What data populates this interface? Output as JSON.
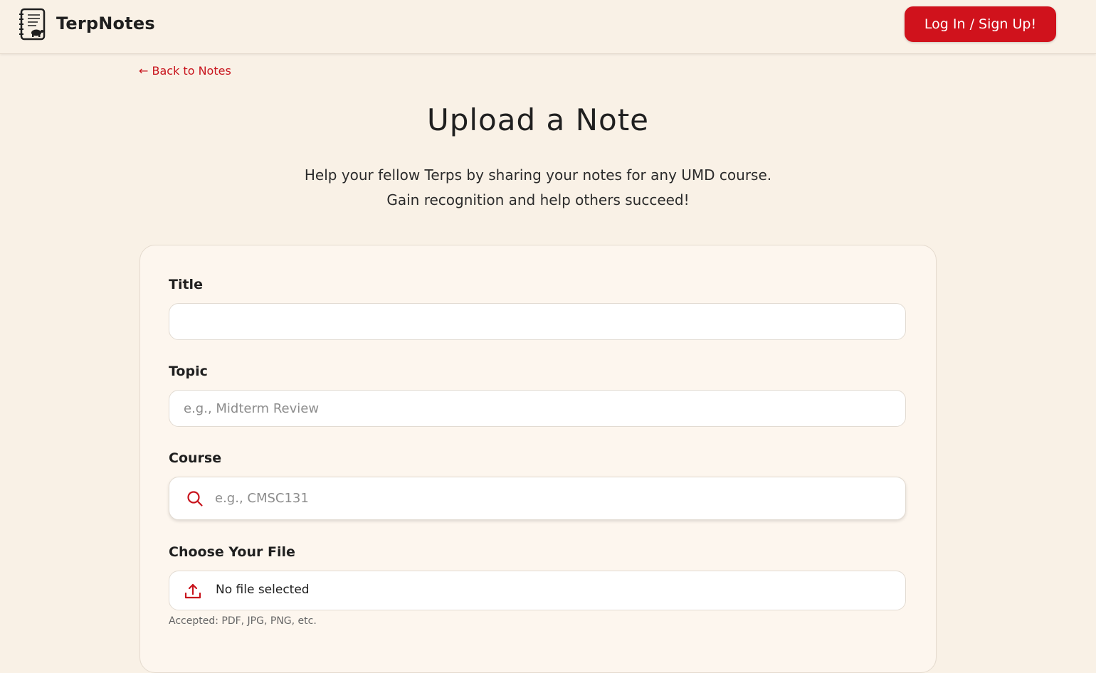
{
  "header": {
    "brand": "TerpNotes",
    "login_label": "Log In / Sign Up!"
  },
  "nav": {
    "back_label": "← Back to Notes"
  },
  "main": {
    "title": "Upload a Note",
    "subtitle_line1": "Help your fellow Terps by sharing your notes for any UMD course.",
    "subtitle_line2": "Gain recognition and help others succeed!"
  },
  "form": {
    "title": {
      "label": "Title",
      "value": "",
      "placeholder": ""
    },
    "topic": {
      "label": "Topic",
      "value": "",
      "placeholder": "e.g., Midterm Review"
    },
    "course": {
      "label": "Course",
      "value": "",
      "placeholder": "e.g., CMSC131"
    },
    "file": {
      "label": "Choose Your File",
      "status": "No file selected",
      "accepted": "Accepted: PDF, JPG, PNG, etc."
    }
  },
  "icons": {
    "logo": "notebook-turtle-icon",
    "search": "search-icon",
    "upload": "upload-icon"
  },
  "colors": {
    "accent": "#d0121c",
    "background": "#f9f1e6",
    "card": "#fdf6ee"
  }
}
